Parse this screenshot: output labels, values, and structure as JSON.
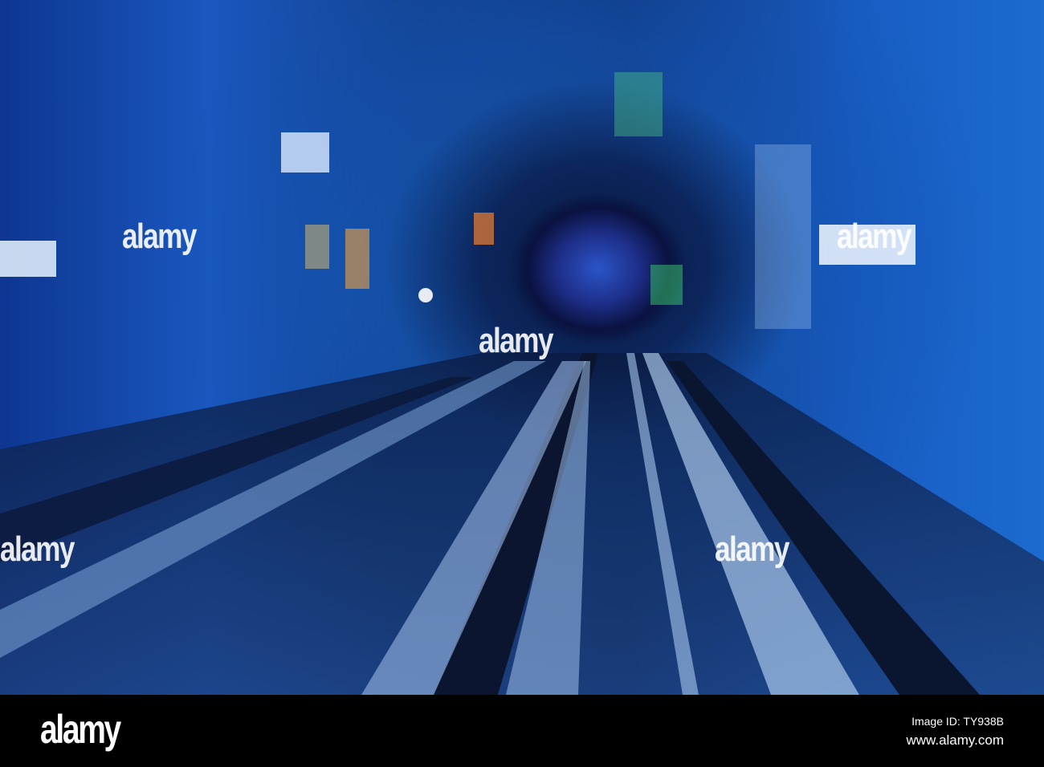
{
  "watermark": {
    "text": "alamy"
  },
  "footer": {
    "logo": "alamy",
    "image_id": "Image ID: TY938B",
    "url": "www.alamy.com"
  }
}
